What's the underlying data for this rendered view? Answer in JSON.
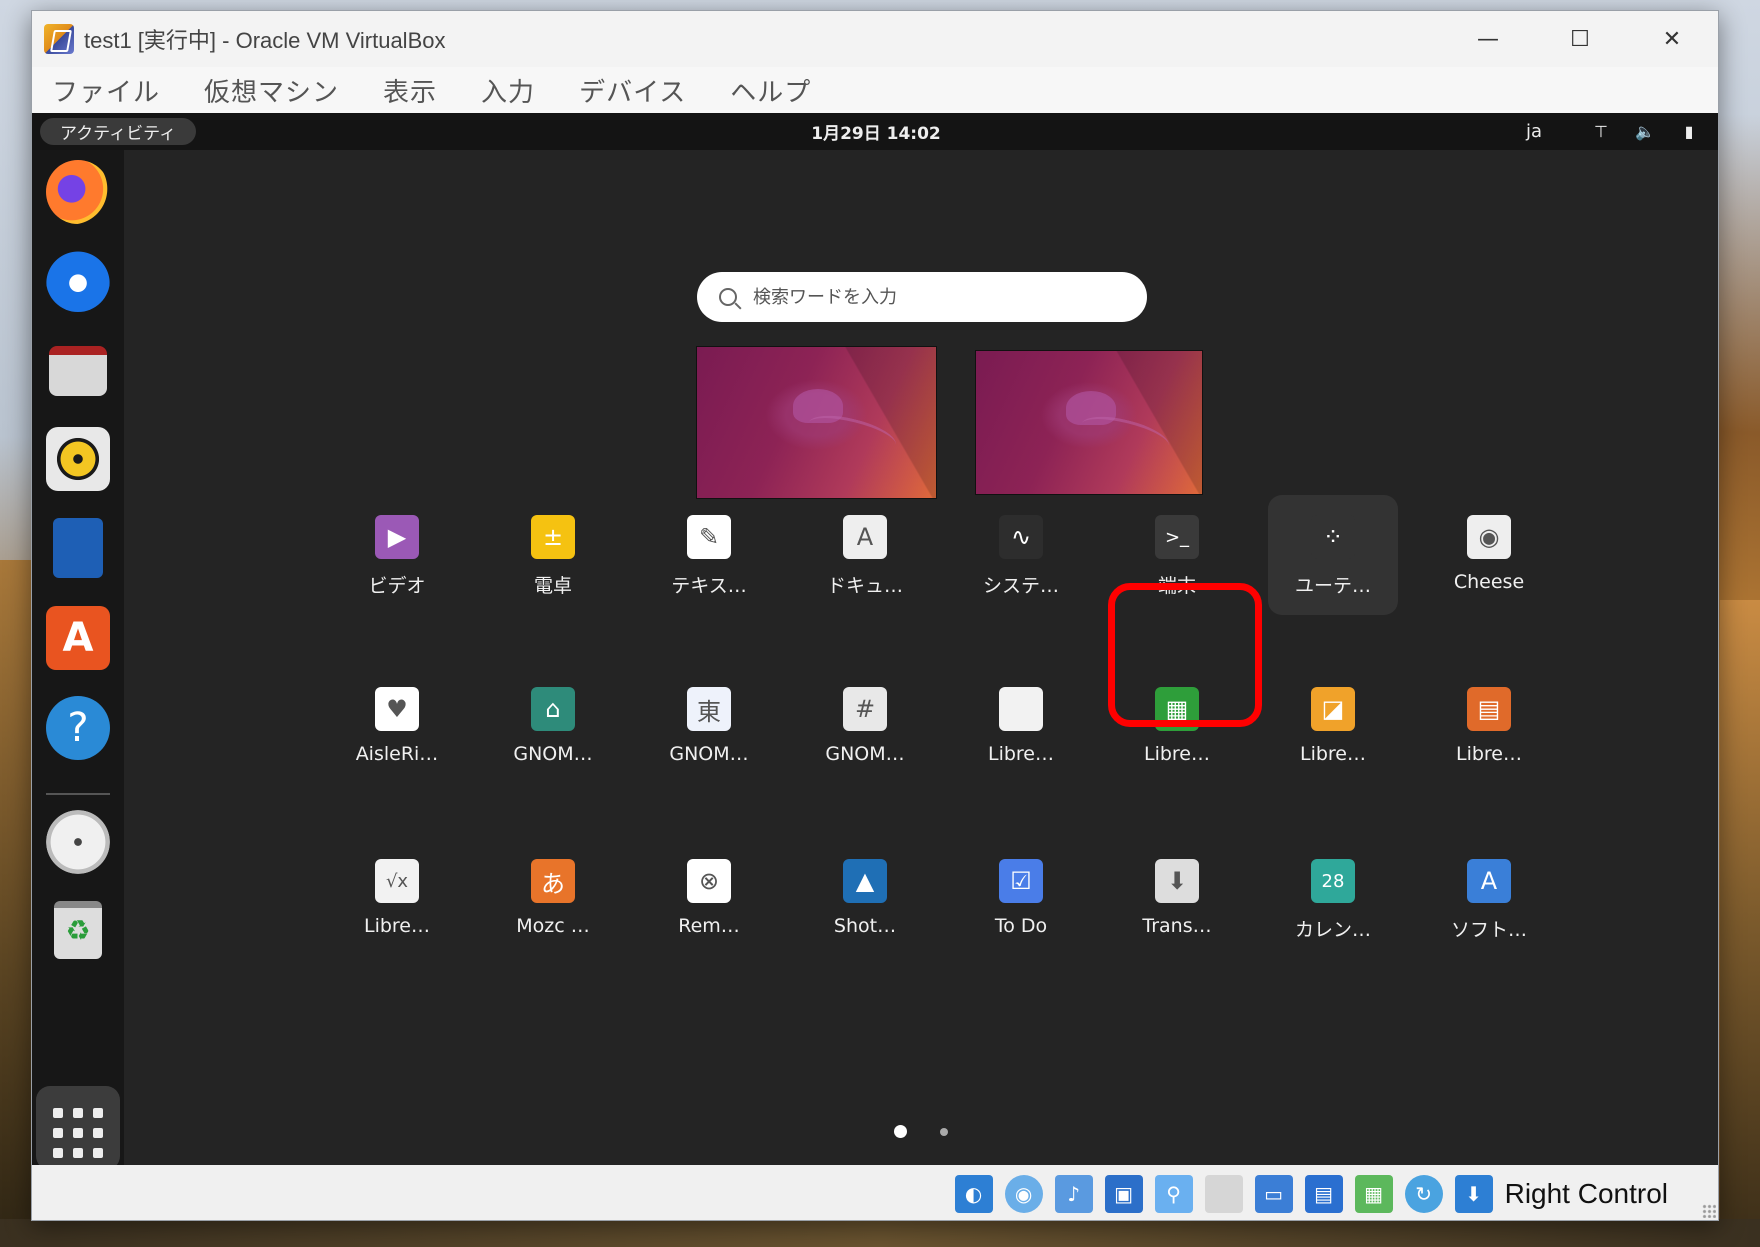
{
  "window": {
    "title": "test1 [実行中] - Oracle VM VirtualBox",
    "controls": {
      "minimize": "—",
      "maximize": "☐",
      "close": "✕"
    }
  },
  "menu": {
    "items": [
      "ファイル",
      "仮想マシン",
      "表示",
      "入力",
      "デバイス",
      "ヘルプ"
    ]
  },
  "guest": {
    "topbar": {
      "activities": "アクティビティ",
      "clock": "1月29日  14:02",
      "lang": "ja",
      "icons": [
        "network-icon",
        "volume-icon",
        "battery-icon"
      ]
    },
    "dock": {
      "items": [
        "firefox-icon",
        "thunderbird-icon",
        "files-icon",
        "rhythmbox-icon",
        "libreoffice-writer-icon",
        "ubuntu-software-icon",
        "help-icon",
        "disc-icon",
        "trash-icon",
        "show-apps-icon"
      ]
    },
    "search": {
      "placeholder": "検索ワードを入力"
    },
    "apps": [
      {
        "label": "ビデオ",
        "icon": "video-icon",
        "color": "#9b59b6",
        "glyph": "▶"
      },
      {
        "label": "電卓",
        "icon": "calculator-icon",
        "color": "#f5c211",
        "glyph": "±"
      },
      {
        "label": "テキス…",
        "icon": "text-editor-icon",
        "color": "#ffffff",
        "glyph": "✎"
      },
      {
        "label": "ドキュ…",
        "icon": "document-viewer-icon",
        "color": "#eeeeee",
        "glyph": "A"
      },
      {
        "label": "システ…",
        "icon": "system-monitor-icon",
        "color": "#2d2d2d",
        "glyph": "∿"
      },
      {
        "label": "端末",
        "icon": "terminal-icon",
        "color": "#3a3a3a",
        "glyph": ">_"
      },
      {
        "label": "ユーテ…",
        "icon": "utilities-folder-icon",
        "color": "#333333",
        "glyph": "⁘"
      },
      {
        "label": "Cheese",
        "icon": "cheese-icon",
        "color": "#eeeeee",
        "glyph": "◉"
      },
      {
        "label": "AisleRi…",
        "icon": "aisleriot-icon",
        "color": "#ffffff",
        "glyph": "♥"
      },
      {
        "label": "GNOM…",
        "icon": "gnome-mahjongg-icon",
        "color": "#2e8b7a",
        "glyph": "⌂"
      },
      {
        "label": "GNOM…",
        "icon": "gnome-mahjongg-tile-icon",
        "color": "#eef2fb",
        "glyph": "東"
      },
      {
        "label": "GNOM…",
        "icon": "gnome-sudoku-icon",
        "color": "#e8e8e8",
        "glyph": "#"
      },
      {
        "label": "Libre…",
        "icon": "libreoffice-icon",
        "color": "#f2f2f2",
        "glyph": ""
      },
      {
        "label": "Libre…",
        "icon": "libreoffice-calc-icon",
        "color": "#2e9e3a",
        "glyph": "▦"
      },
      {
        "label": "Libre…",
        "icon": "libreoffice-draw-icon",
        "color": "#f0a22a",
        "glyph": "◪"
      },
      {
        "label": "Libre…",
        "icon": "libreoffice-impress-icon",
        "color": "#e06a2a",
        "glyph": "▤"
      },
      {
        "label": "Libre…",
        "icon": "libreoffice-math-icon",
        "color": "#f2f2f2",
        "glyph": "√x"
      },
      {
        "label": "Mozc …",
        "icon": "mozc-icon",
        "color": "#e8742a",
        "glyph": "あ"
      },
      {
        "label": "Rem…",
        "icon": "remmina-icon",
        "color": "#ffffff",
        "glyph": "⊗"
      },
      {
        "label": "Shot…",
        "icon": "shotwell-icon",
        "color": "#1f6fb5",
        "glyph": "▲"
      },
      {
        "label": "To Do",
        "icon": "todo-icon",
        "color": "#4a7de8",
        "glyph": "☑"
      },
      {
        "label": "Trans…",
        "icon": "transmission-icon",
        "color": "#dddddd",
        "glyph": "⬇"
      },
      {
        "label": "カレン…",
        "icon": "calendar-icon",
        "color": "#2fa89a",
        "glyph": "28"
      },
      {
        "label": "ソフト…",
        "icon": "software-icon",
        "color": "#3a7fd8",
        "glyph": "A"
      }
    ],
    "highlighted_app": "端末",
    "pages": {
      "count": 2,
      "current": 1
    }
  },
  "statusbar": {
    "icons": [
      "hard-disk-icon",
      "optical-drive-icon",
      "audio-icon",
      "network-adapter-icon",
      "usb-icon",
      "shared-folder-icon",
      "display-icon",
      "snapshot-icon",
      "recording-icon",
      "cpu-icon",
      "keyboard-capture-icon"
    ],
    "host_key": "Right Control"
  },
  "colors": {
    "highlight": "#ff0000",
    "guest_bg": "#242424",
    "dock_bg": "#171717"
  }
}
